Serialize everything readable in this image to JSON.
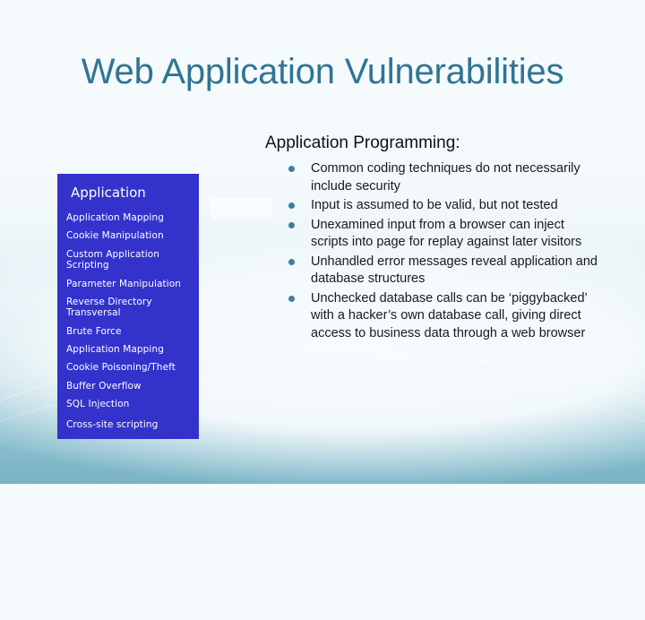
{
  "slide": {
    "title": "Web Application Vulnerabilities",
    "colors": {
      "title": "#2f7593",
      "box_fill": "#3333cc",
      "box_text": "#ffffff",
      "bullet": "#3e7f99"
    }
  },
  "vulnerability_box": {
    "heading": "Application",
    "items": [
      "Application Mapping",
      "Cookie Manipulation",
      "Custom Application Scripting",
      "Parameter Manipulation",
      "Reverse Directory Transversal",
      "Brute Force",
      "Application Mapping",
      "Cookie Poisoning/Theft",
      "Buffer Overflow",
      "SQL Injection",
      "Cross-site scripting"
    ]
  },
  "content": {
    "heading": "Application Programming:",
    "bullet_icon": "bullet-dot",
    "bullets": [
      "Common coding techniques do not necessarily include security",
      "Input is assumed to be valid, but not tested",
      "Unexamined input from a browser can inject scripts into page for replay against later visitors",
      "Unhandled error messages reveal application and database structures",
      "Unchecked database calls can be ‘piggybacked’ with a hacker’s own database call, giving direct access to business data through a web browser"
    ]
  }
}
